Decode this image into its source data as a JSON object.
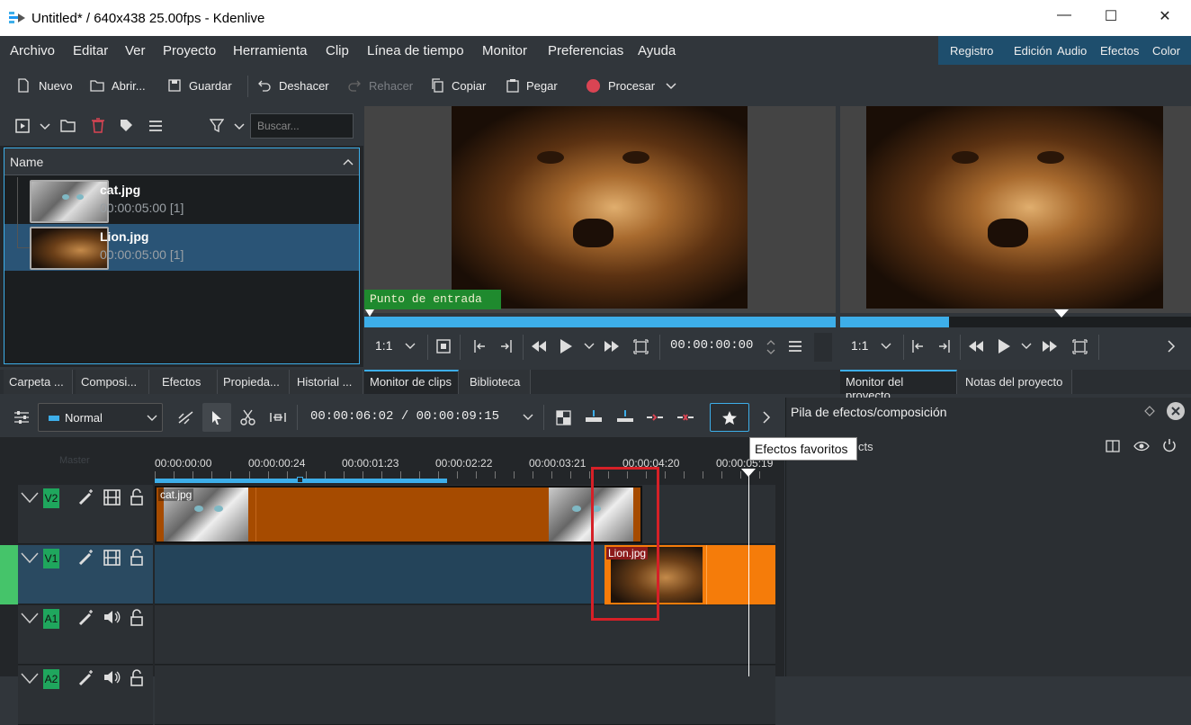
{
  "window": {
    "title": "Untitled* / 640x438 25.00fps - Kdenlive",
    "minimize": "—",
    "maximize": "☐",
    "close": "✕"
  },
  "menu": [
    "Archivo",
    "Editar",
    "Ver",
    "Proyecto",
    "Herramienta",
    "Clip",
    "Línea de tiempo",
    "Monitor",
    "Preferencias",
    "Ayuda"
  ],
  "layouts": [
    "Registro",
    "Edición",
    "Audio",
    "Efectos",
    "Color"
  ],
  "toolbar": {
    "nuevo": "Nuevo",
    "abrir": "Abrir...",
    "guardar": "Guardar",
    "deshacer": "Deshacer",
    "rehacer": "Rehacer",
    "copiar": "Copiar",
    "pegar": "Pegar",
    "procesar": "Procesar"
  },
  "bin": {
    "search_placeholder": "Buscar...",
    "column": "Name",
    "items": [
      {
        "name": "cat.jpg",
        "duration": "00:00:05:00 [1]"
      },
      {
        "name": "Lion.jpg",
        "duration": "00:00:05:00 [1]"
      }
    ]
  },
  "left_tabs": [
    "Carpeta ...",
    "Composi...",
    "Efectos",
    "Propieda...",
    "Historial ...",
    "Monitor de clips",
    "Biblioteca"
  ],
  "clip_monitor": {
    "overlay": "Punto de entrada",
    "zoom": "1:1",
    "timecode": "00:00:00:00"
  },
  "project_monitor": {
    "zoom": "1:1"
  },
  "right_tabs": [
    "Monitor del proyecto",
    "Notas del proyecto"
  ],
  "timeline": {
    "mode": "Normal",
    "position": "00:00:06:02 / 00:00:09:15",
    "master": "Master",
    "ruler": [
      "00:00:00:00",
      "00:00:00:24",
      "00:00:01:23",
      "00:00:02:22",
      "00:00:03:21",
      "00:00:04:20",
      "00:00:05:19"
    ],
    "tracks": [
      "V2",
      "V1",
      "A1",
      "A2"
    ],
    "clips": {
      "cat": "cat.jpg",
      "lion": "Lion.jpg"
    }
  },
  "effects_panel": {
    "title": "Pila de efectos/composición",
    "partial": "cts"
  },
  "tooltip": "Efectos favoritos",
  "colors": {
    "accent": "#3daee9",
    "clip_orange": "#f57c0a",
    "clip_dark_orange": "#a64b00",
    "track_green": "#1fa65d",
    "highlight": "#d62027",
    "layout_bar": "#1e4e6d"
  }
}
